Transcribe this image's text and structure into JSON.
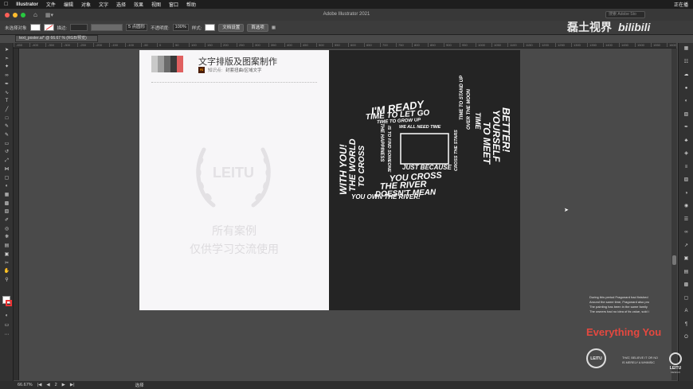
{
  "menubar": {
    "app": "Illustrator",
    "items": [
      "文件",
      "编辑",
      "对象",
      "文字",
      "选择",
      "效果",
      "视图",
      "窗口",
      "帮助"
    ],
    "right_text": "正在播"
  },
  "window": {
    "title": "Adobe Illustrator 2021",
    "search_placeholder": "搜索 Adobe Sto"
  },
  "control_bar": {
    "selection": "未选择对象",
    "stroke_label": "描边:",
    "brush_value": "5 点圆形",
    "opacity_label": "不透明度:",
    "opacity_value": "100%",
    "style_label": "样式:",
    "doc_setup": "文档设置",
    "preferences": "首选项"
  },
  "doc_tab": {
    "label": "text_poster.ai* @ 66.67 % (RGB/预览)"
  },
  "ruler_marks": [
    "-450",
    "-400",
    "-350",
    "-300",
    "-250",
    "-200",
    "-150",
    "-100",
    "-50",
    "0",
    "50",
    "100",
    "150",
    "200",
    "250",
    "300",
    "350",
    "400",
    "450",
    "500",
    "550",
    "600",
    "650",
    "700",
    "750",
    "800",
    "850",
    "900",
    "950",
    "1000",
    "1050",
    "1100",
    "1150",
    "1200",
    "1250",
    "1300",
    "1350",
    "1400",
    "1450",
    "1500",
    "1550",
    "1600"
  ],
  "artboard_left": {
    "title": "文字排版及图案制作",
    "tag_logo": "Ai",
    "tag_label": "知识点:",
    "tag_value": "封套扭曲/区域文字",
    "palette": [
      "#c9c9c9",
      "#9e9e9e",
      "#6b6b6b",
      "#3a3a3a",
      "#e06060"
    ],
    "watermark_logo_text": "LEITU",
    "watermark_line1": "所有案例",
    "watermark_line2": "仅供学习交流使用"
  },
  "artboard_right": {
    "outer_top": "I'M READY",
    "outer_top2": "TIME TO LET GO",
    "outer_left": "WITH YOU!",
    "outer_left2": "THE WORLD",
    "outer_left3": "TO CROSS",
    "outer_right": "BETTER!",
    "outer_right2": "YOURSELF",
    "outer_right3": "TO MEET",
    "outer_right4": "TIME",
    "outer_bottom": "YOU OWN THE RIVER!",
    "outer_bottom2": "DOESN'T MEAN",
    "outer_bottom3": "THE RIVER",
    "outer_bottom4": "YOU CROSS",
    "inner_top": "TIME TO GROW UP",
    "inner_top2": "WE ALL NEED TIME",
    "inner_left": "THE HAPPINESS",
    "inner_left2": "IS TO FIND SOMEONE",
    "inner_right": "TIME TO STAND UP",
    "inner_right2": "OVER THE MOON",
    "inner_right3": "CROSS THE STARS",
    "inner_bottom": "JUST BECAUSE"
  },
  "overlay": {
    "channel": "磊土视界",
    "bili": "bilibili",
    "para": [
      "During this period Fragonard had finished",
      "Around the same time, Fragonard also pro",
      "The painting has been in the same family",
      "The owners had no idea of its value, sold i"
    ],
    "headline": "Everything You",
    "brand": "LEITU",
    "note1": "THAT, BELIEVE IT OR NO",
    "note2": "IS MERELY A WHIMSIC",
    "corner_label": "LEITU",
    "corner_sub": "DESIGN"
  },
  "status": {
    "zoom": "66.67%",
    "page": "2",
    "tool": "选择"
  }
}
